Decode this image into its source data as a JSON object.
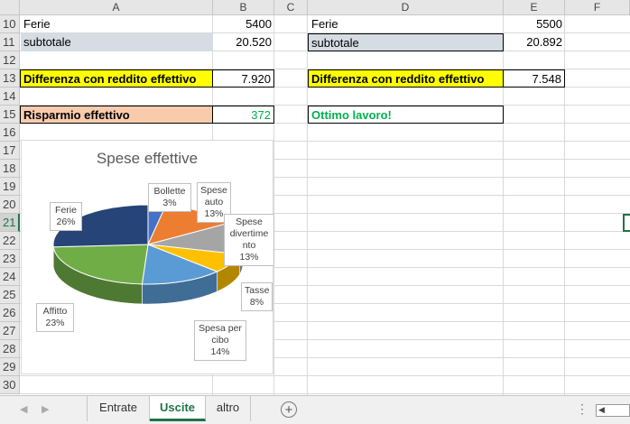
{
  "columns": [
    "A",
    "B",
    "C",
    "D",
    "E",
    "F"
  ],
  "rows": [
    "10",
    "11",
    "12",
    "13",
    "14",
    "15",
    "16",
    "17",
    "18",
    "19",
    "20",
    "21",
    "22",
    "23",
    "24",
    "25",
    "26",
    "27",
    "28",
    "29",
    "30"
  ],
  "selected_row": "21",
  "cells": {
    "a10": "Ferie",
    "b10": "5400",
    "d10": "Ferie",
    "e10": "5500",
    "a11": "subtotale",
    "b11": "20.520",
    "d11": "subtotale",
    "e11": "20.892",
    "a13": "Differenza con reddito effettivo",
    "b13": "7.920",
    "d13": "Differenza con reddito effettivo",
    "e13": "7.548",
    "a15": "Risparmio effettivo",
    "b15": "372",
    "d15": "Ottimo lavoro!"
  },
  "colors": {
    "highlight_yellow": "#ffff00",
    "subtotal_fill": "#d6dce4",
    "risparmio_fill": "#f8cbad",
    "green_text": "#00b050",
    "accent": "#217346"
  },
  "chart_data": {
    "type": "pie",
    "title": "Spese effettive",
    "slices": [
      {
        "name": "Bollette",
        "value": 3,
        "label": "3%",
        "color": "#4472c4"
      },
      {
        "name": "Spese auto",
        "value": 13,
        "label": "13%",
        "color": "#ed7d31"
      },
      {
        "name": "Spese divertimento",
        "value": 13,
        "label": "13%",
        "color": "#a5a5a5"
      },
      {
        "name": "Tasse",
        "value": 8,
        "label": "8%",
        "color": "#ffc000"
      },
      {
        "name": "Spesa per cibo",
        "value": 14,
        "label": "14%",
        "color": "#5b9bd5"
      },
      {
        "name": "Affitto",
        "value": 23,
        "label": "23%",
        "color": "#70ad47"
      },
      {
        "name": "Ferie",
        "value": 26,
        "label": "26%",
        "color": "#264478"
      }
    ],
    "data_labels": {
      "bollette": [
        "Bollette",
        "3%"
      ],
      "auto": [
        "Spese",
        "auto",
        "13%"
      ],
      "divertimento": [
        "Spese",
        "divertime",
        "nto",
        "13%"
      ],
      "tasse": [
        "Tasse",
        "8%"
      ],
      "cibo": [
        "Spesa per",
        "cibo",
        "14%"
      ],
      "affitto": [
        "Affitto",
        "23%"
      ],
      "ferie": [
        "Ferie",
        "26%"
      ]
    }
  },
  "sheet_tabs": [
    "Entrate",
    "Uscite",
    "altro"
  ],
  "active_tab": "Uscite"
}
